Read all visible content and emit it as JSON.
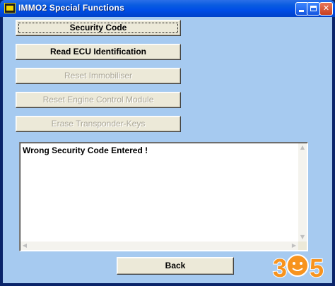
{
  "window": {
    "title": "IMMO2 Special Functions"
  },
  "buttons": {
    "security_code": "Security Code",
    "read_ecu": "Read ECU Identification",
    "reset_immobiliser": "Reset Immobiliser",
    "reset_ecm": "Reset Engine Control Module",
    "erase_keys": "Erase Transponder-Keys",
    "back": "Back"
  },
  "output": {
    "message": "Wrong Security Code Entered !"
  },
  "watermark": {
    "text": "365"
  },
  "colors": {
    "dialog_background": "#a6caf0",
    "titlebar": "#0a5ce0",
    "button_face": "#ece9d8",
    "watermark_orange": "#f7931e"
  }
}
